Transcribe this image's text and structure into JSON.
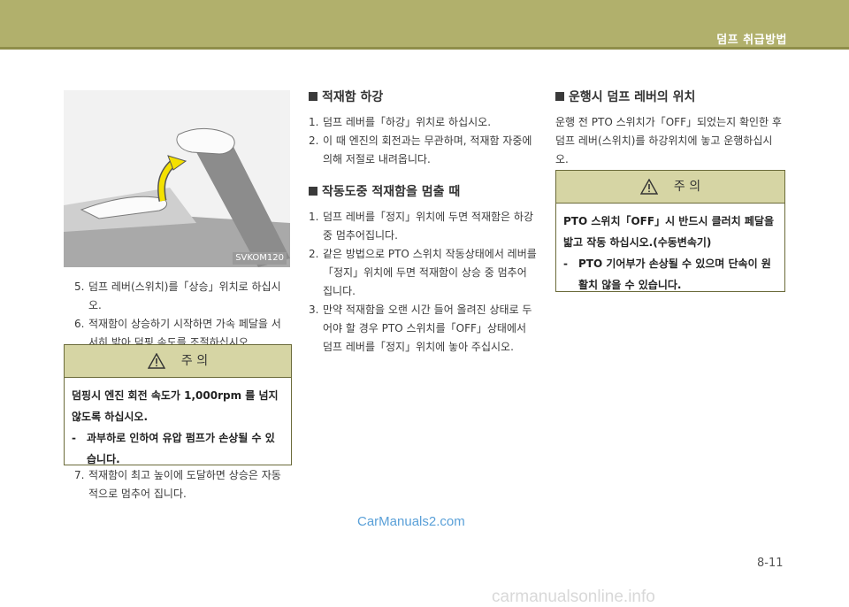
{
  "header": {
    "title": "덤프 취급방법"
  },
  "figure": {
    "code": "SVKOM120"
  },
  "left": {
    "steps_top": [
      {
        "num": "5.",
        "text": "덤프 레버(스위치)를「상승」위치로 하십시오."
      },
      {
        "num": "6.",
        "text": "적재함이 상승하기 시작하면 가속 페달을 서서히 밟아 덤핑 속도를 조절하십시오."
      }
    ],
    "caution": {
      "title": "주   의",
      "line1": "덤핑시 엔진 회전 속도가 1,000rpm 를 넘지 않도록 하십시오.",
      "dash": "-",
      "line2": "과부하로 인하여 유압 펌프가 손상될 수 있습니다."
    },
    "steps_bottom": [
      {
        "num": "7.",
        "text": "적재함이 최고 높이에 도달하면 상승은 자동적으로 멈추어 집니다."
      }
    ]
  },
  "middle": {
    "sec1": {
      "title": "적재함 하강",
      "items": [
        {
          "num": "1.",
          "text": "덤프 레버를「하강」위치로 하십시오."
        },
        {
          "num": "2.",
          "text": "이 때 엔진의 회전과는 무관하며, 적재함 자중에 의해 저절로 내려옵니다."
        }
      ]
    },
    "sec2": {
      "title": "작동도중 적재함을 멈출 때",
      "items": [
        {
          "num": "1.",
          "text": "덤프 레버를「정지」위치에 두면 적재함은 하강중 멈추어집니다."
        },
        {
          "num": "2.",
          "text": "같은 방법으로 PTO 스위치 작동상태에서 레버를「정지」위치에 두면 적재함이 상승 중 멈추어 집니다."
        },
        {
          "num": "3.",
          "text": "만약 적재함을 오랜 시간 들어 올려진 상태로 두어야 할 경우 PTO 스위치를「OFF」상태에서 덤프 레버를「정지」위치에 놓아 주십시오."
        }
      ]
    }
  },
  "right": {
    "sec": {
      "title": "운행시 덤프 레버의 위치",
      "text": "운행 전 PTO 스위치가「OFF」되었는지 확인한 후 덤프 레버(스위치)를 하강위치에 놓고 운행하십시오."
    },
    "caution": {
      "title": "주   의",
      "line1": "PTO 스위치「OFF」시 반드시 클러치 페달을 밟고 작동 하십시오.(수동변속기)",
      "dash": "-",
      "line2": "PTO 기어부가 손상될 수 있으며 단속이 원활치 않을 수 있습니다."
    }
  },
  "watermark": "CarManuals2.com",
  "page_number": "8-11",
  "bottom_watermark": "carmanualsonline.info"
}
